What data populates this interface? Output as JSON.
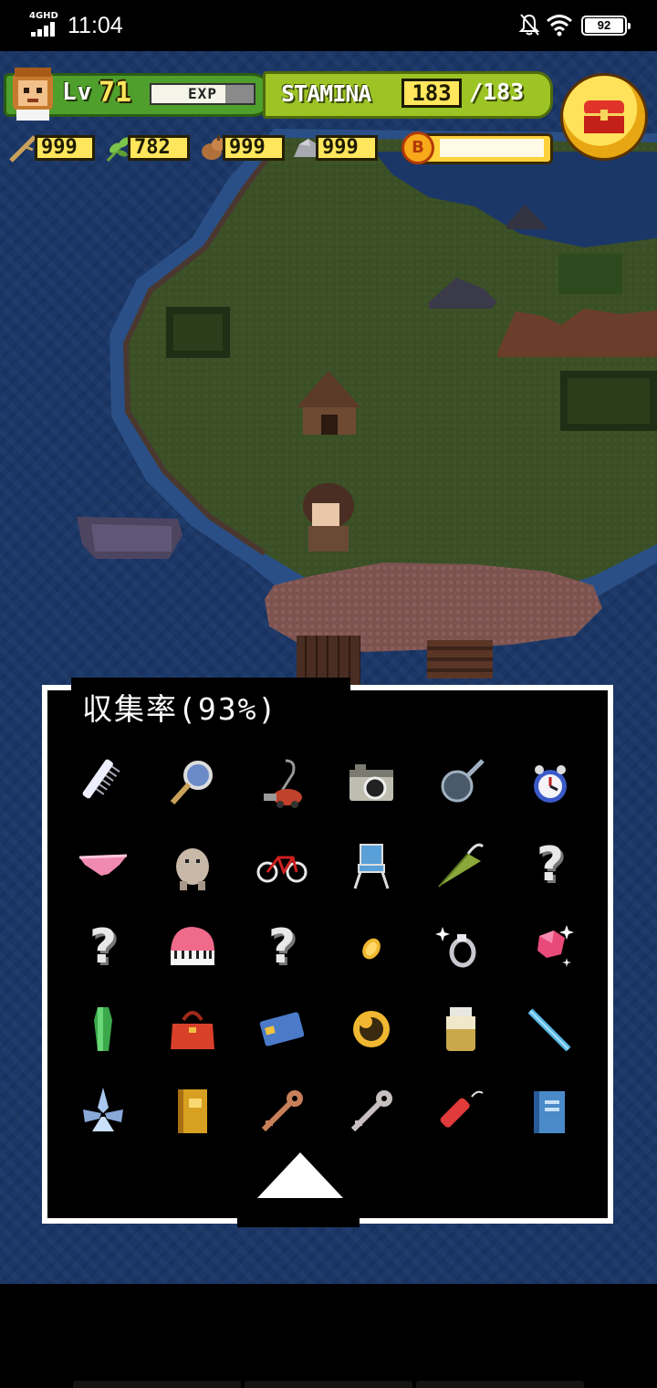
{
  "status_bar": {
    "network": "4GHD",
    "time": "11:04",
    "battery": "92",
    "icons": [
      "signal-icon",
      "bell-off-icon",
      "wifi-icon",
      "battery-icon"
    ]
  },
  "hud": {
    "level_label": "Lv",
    "level_value": "71",
    "exp_label": "EXP",
    "exp_fraction": 0.72,
    "stamina_label": "STAMINA",
    "stamina_current": "183",
    "stamina_max": "/183",
    "coin_fraction": 1.0,
    "coin_symbol": "B",
    "resources": [
      {
        "icon": "wood-stick-icon",
        "value": "999"
      },
      {
        "icon": "herb-leaf-icon",
        "value": "782"
      },
      {
        "icon": "nut-icon",
        "value": "999"
      },
      {
        "icon": "stone-icon",
        "value": "999"
      }
    ],
    "treasure_button_icon": "treasure-chest-icon"
  },
  "collection": {
    "title": "収集率(93%)",
    "rows": [
      [
        "comb-icon",
        "magnifying-glass-icon",
        "vacuum-cleaner-icon",
        "camera-icon",
        "frying-pan-icon",
        "alarm-clock-icon"
      ],
      [
        "pink-underwear-icon",
        "plush-creature-icon",
        "red-bicycle-icon",
        "folding-chair-icon",
        "green-umbrella-icon",
        "unknown"
      ],
      [
        "unknown",
        "pink-piano-icon",
        "unknown",
        "gold-coin-icon",
        "silver-ring-icon",
        "pink-gem-icon"
      ],
      [
        "green-crystal-icon",
        "red-handbag-icon",
        "blue-card-icon",
        "gold-ring-icon",
        "jar-icon",
        "blue-pen-icon"
      ],
      [
        "ice-crystal-icon",
        "golden-book-icon",
        "bronze-key-icon",
        "silver-key-icon",
        "dynamite-icon",
        "blue-book-icon"
      ]
    ],
    "unknown_symbol": "?",
    "scroll_up_icon": "up-arrow-icon"
  },
  "colors": {
    "sea": "#1b3768",
    "grass": "#3b4f26",
    "sand": "#8a5c5a",
    "level_bar": "#4f9f2c",
    "stamina_bar": "#9cc425",
    "value_yellow": "#ffe65c"
  }
}
